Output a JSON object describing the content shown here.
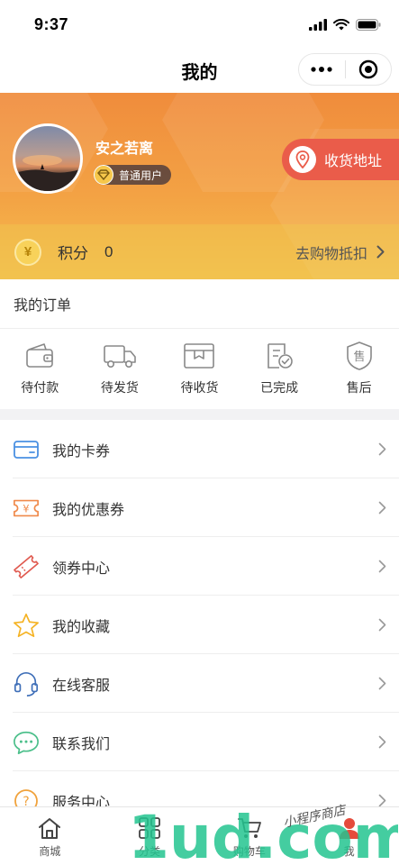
{
  "status_bar": {
    "time": "9:37"
  },
  "nav": {
    "title": "我的",
    "more_icon": "more-dots-icon",
    "close_icon": "target-circle-icon"
  },
  "profile": {
    "name": "安之若离",
    "level": "普通用户",
    "address_label": "收货地址"
  },
  "points": {
    "label": "积分",
    "value": "0",
    "link": "去购物抵扣",
    "coin_symbol": "¥"
  },
  "orders": {
    "title": "我的订单",
    "items": [
      {
        "label": "待付款",
        "icon": "wallet-icon"
      },
      {
        "label": "待发货",
        "icon": "truck-icon"
      },
      {
        "label": "待收货",
        "icon": "package-icon"
      },
      {
        "label": "已完成",
        "icon": "completed-doc-icon"
      },
      {
        "label": "售后",
        "icon": "after-sale-shield-icon"
      }
    ]
  },
  "menu": {
    "items": [
      {
        "label": "我的卡券",
        "icon": "card-icon"
      },
      {
        "label": "我的优惠券",
        "icon": "coupon-icon"
      },
      {
        "label": "领券中心",
        "icon": "ticket-icon"
      },
      {
        "label": "我的收藏",
        "icon": "star-icon"
      },
      {
        "label": "在线客服",
        "icon": "headset-icon"
      },
      {
        "label": "联系我们",
        "icon": "chat-bubble-icon"
      },
      {
        "label": "服务中心",
        "icon": "help-icon"
      }
    ]
  },
  "tabs": [
    {
      "label": "商城",
      "icon": "home-icon"
    },
    {
      "label": "分类",
      "icon": "category-icon"
    },
    {
      "label": "购物车",
      "icon": "cart-icon"
    },
    {
      "label": "我",
      "icon": "user-icon"
    }
  ],
  "watermark": {
    "text": "1ud.com",
    "subtext": "小程序商店"
  },
  "colors": {
    "header_top": "#f08c3c",
    "header_bottom": "#f5bf4f",
    "address_button": "#ea5c4a",
    "watermark_green": "#23c48f",
    "watermark_red": "#e54b3c"
  }
}
